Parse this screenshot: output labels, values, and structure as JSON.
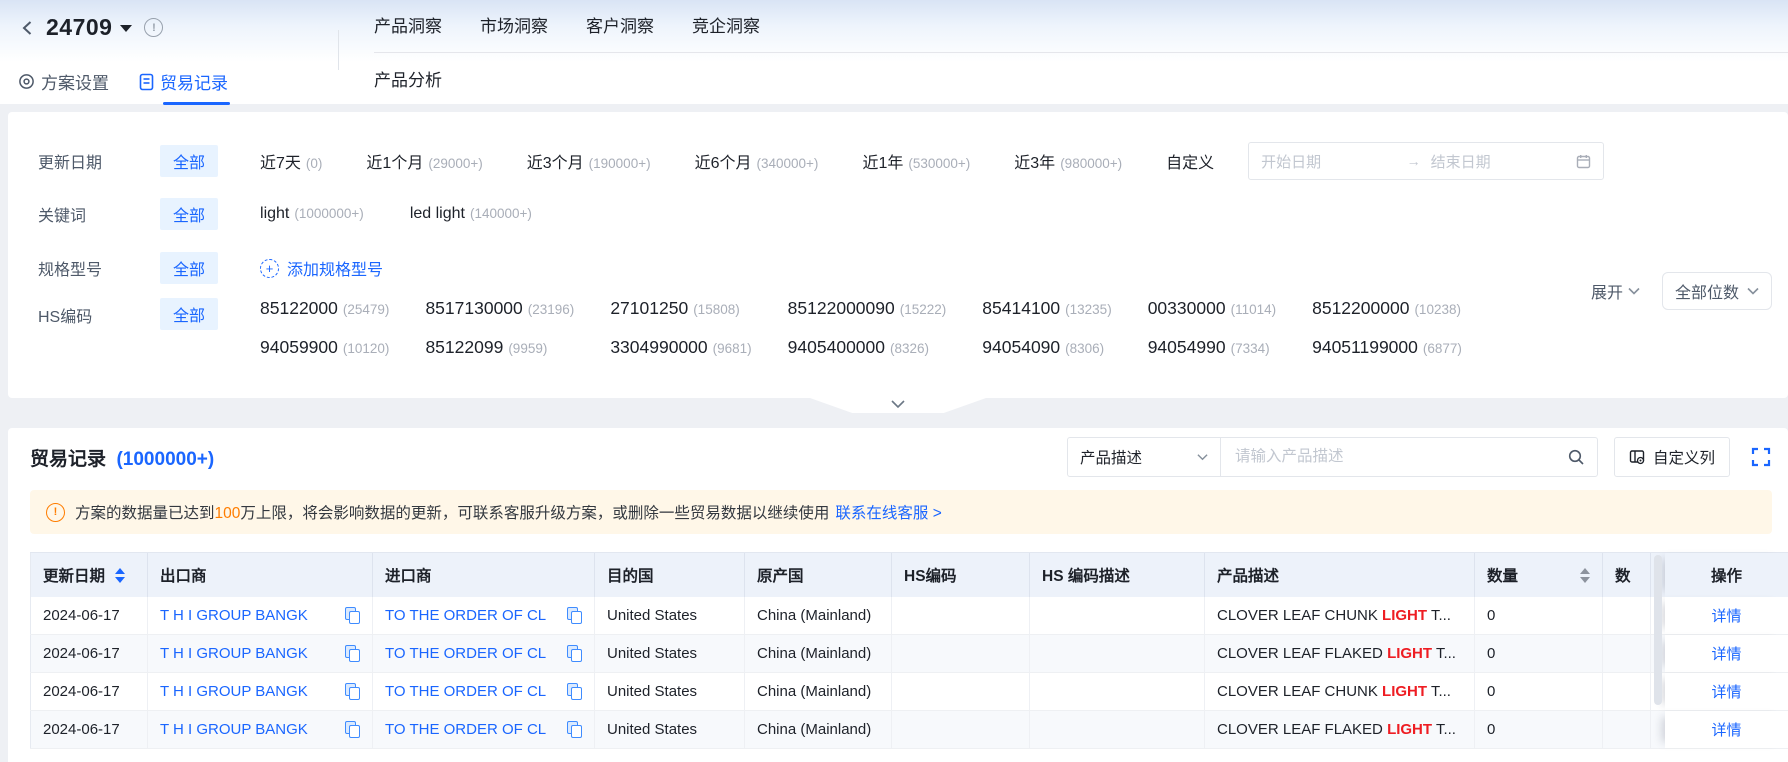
{
  "brand": {
    "primary_blue": "#1a66ff",
    "warn_orange": "#ff7d00",
    "highlight_red": "#ee1d23"
  },
  "header": {
    "title": "24709",
    "plan_tabs": [
      {
        "label": "方案设置"
      },
      {
        "label": "贸易记录"
      }
    ],
    "nav": [
      {
        "label": "产品洞察"
      },
      {
        "label": "市场洞察"
      },
      {
        "label": "客户洞察"
      },
      {
        "label": "竞企洞察"
      }
    ],
    "subnav": {
      "label": "产品分析"
    }
  },
  "filters": {
    "date": {
      "label": "更新日期",
      "all": "全部",
      "options": [
        {
          "name": "近7天",
          "count": "(0)"
        },
        {
          "name": "近1个月",
          "count": "(29000+)"
        },
        {
          "name": "近3个月",
          "count": "(190000+)"
        },
        {
          "name": "近6个月",
          "count": "(340000+)"
        },
        {
          "name": "近1年",
          "count": "(530000+)"
        },
        {
          "name": "近3年",
          "count": "(980000+)"
        }
      ],
      "custom_label": "自定义",
      "start_placeholder": "开始日期",
      "end_placeholder": "结束日期",
      "range_arrow": "→"
    },
    "keyword": {
      "label": "关键词",
      "all": "全部",
      "options": [
        {
          "name": "light",
          "count": "(1000000+)"
        },
        {
          "name": "led light",
          "count": "(140000+)"
        }
      ]
    },
    "spec": {
      "label": "规格型号",
      "all": "全部",
      "add_label": "添加规格型号",
      "add_plus": "+"
    },
    "hs": {
      "label": "HS编码",
      "all": "全部",
      "options": [
        {
          "name": "85122000",
          "count": "(25479)"
        },
        {
          "name": "8517130000",
          "count": "(23196)"
        },
        {
          "name": "27101250",
          "count": "(15808)"
        },
        {
          "name": "85122000090",
          "count": "(15222)"
        },
        {
          "name": "85414100",
          "count": "(13235)"
        },
        {
          "name": "00330000",
          "count": "(11014)"
        },
        {
          "name": "8512200000",
          "count": "(10238)"
        },
        {
          "name": "94059900",
          "count": "(10120)"
        },
        {
          "name": "85122099",
          "count": "(9959)"
        },
        {
          "name": "3304990000",
          "count": "(9681)"
        },
        {
          "name": "9405400000",
          "count": "(8326)"
        },
        {
          "name": "94054090",
          "count": "(8306)"
        },
        {
          "name": "94054990",
          "count": "(7334)"
        },
        {
          "name": "94051199000",
          "count": "(6877)"
        }
      ],
      "expand_label": "展开",
      "digits_label": "全部位数"
    }
  },
  "records": {
    "title": "贸易记录",
    "count": "(1000000+)",
    "search_category": "产品描述",
    "search_placeholder": "请输入产品描述",
    "customize_label": "自定义列",
    "banner": {
      "icon": "!",
      "prefix": "方案的数据量已达到",
      "highlight": "100",
      "suffix": "万上限，将会影响数据的更新，可联系客服升级方案，或删除一些贸易数据以继续使用",
      "link": "联系在线客服 >"
    },
    "table": {
      "columns": [
        "更新日期",
        "出口商",
        "进口商",
        "目的国",
        "原产国",
        "HS编码",
        "HS 编码描述",
        "产品描述",
        "数量",
        "数",
        "操作"
      ],
      "rows": [
        {
          "date": "2024-06-17",
          "exporter": "T H I GROUP BANGK",
          "importer": "TO THE ORDER OF CL",
          "dest": "United States",
          "origin": "China (Mainland)",
          "hs": "",
          "hs_desc": "",
          "desc_pre": "CLOVER LEAF CHUNK ",
          "desc_hl": "LIGHT",
          "desc_post": " T...",
          "qty": "0",
          "action": "详情"
        },
        {
          "date": "2024-06-17",
          "exporter": "T H I GROUP BANGK",
          "importer": "TO THE ORDER OF CL",
          "dest": "United States",
          "origin": "China (Mainland)",
          "hs": "",
          "hs_desc": "",
          "desc_pre": "CLOVER LEAF FLAKED ",
          "desc_hl": "LIGHT",
          "desc_post": " T...",
          "qty": "0",
          "action": "详情"
        },
        {
          "date": "2024-06-17",
          "exporter": "T H I GROUP BANGK",
          "importer": "TO THE ORDER OF CL",
          "dest": "United States",
          "origin": "China (Mainland)",
          "hs": "",
          "hs_desc": "",
          "desc_pre": "CLOVER LEAF CHUNK ",
          "desc_hl": "LIGHT",
          "desc_post": " T...",
          "qty": "0",
          "action": "详情"
        },
        {
          "date": "2024-06-17",
          "exporter": "T H I GROUP BANGK",
          "importer": "TO THE ORDER OF CL",
          "dest": "United States",
          "origin": "China (Mainland)",
          "hs": "",
          "hs_desc": "",
          "desc_pre": "CLOVER LEAF FLAKED ",
          "desc_hl": "LIGHT",
          "desc_post": " T...",
          "qty": "0",
          "action": "详情"
        }
      ]
    }
  }
}
